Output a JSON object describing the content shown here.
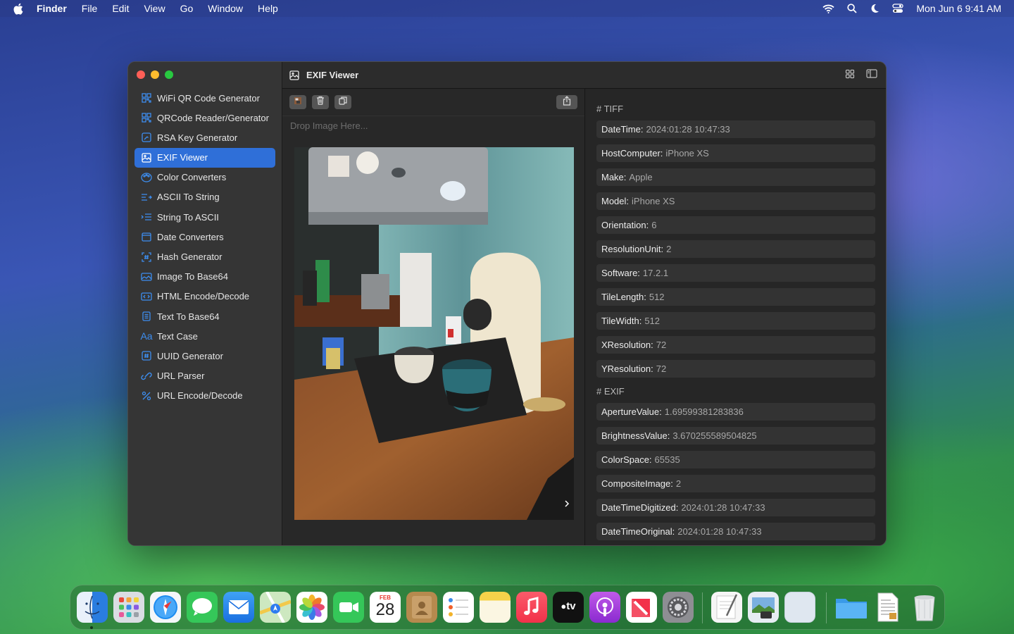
{
  "menubar": {
    "app_name": "Finder",
    "menus": [
      "File",
      "Edit",
      "View",
      "Go",
      "Window",
      "Help"
    ],
    "clock": "Mon Jun 6  9:41 AM"
  },
  "window": {
    "title": "EXIF Viewer",
    "sidebar": {
      "items": [
        {
          "label": "WiFi QR Code Generator",
          "icon": "qrcode-icon"
        },
        {
          "label": "QRCode Reader/Generator",
          "icon": "qrcode-icon"
        },
        {
          "label": "RSA Key Generator",
          "icon": "key-icon"
        },
        {
          "label": "EXIF Viewer",
          "icon": "photo-icon",
          "active": true
        },
        {
          "label": "Color Converters",
          "icon": "palette-icon"
        },
        {
          "label": "ASCII To String",
          "icon": "text-lines-icon"
        },
        {
          "label": "String To ASCII",
          "icon": "list-icon"
        },
        {
          "label": "Date Converters",
          "icon": "calendar-icon"
        },
        {
          "label": "Hash Generator",
          "icon": "hash-scan-icon"
        },
        {
          "label": "Image To Base64",
          "icon": "image-icon"
        },
        {
          "label": "HTML Encode/Decode",
          "icon": "code-icon"
        },
        {
          "label": "Text To Base64",
          "icon": "document-icon"
        },
        {
          "label": "Text Case",
          "icon": "text-case-icon"
        },
        {
          "label": "UUID Generator",
          "icon": "number-icon"
        },
        {
          "label": "URL Parser",
          "icon": "link-icon"
        },
        {
          "label": "URL Encode/Decode",
          "icon": "percent-icon"
        }
      ]
    },
    "left_panel": {
      "drop_placeholder": "Drop Image Here..."
    },
    "exif": {
      "tiff_header": "# TIFF",
      "tiff": [
        {
          "key": "DateTime:",
          "value": "2024:01:28 10:47:33"
        },
        {
          "key": "HostComputer:",
          "value": "iPhone XS"
        },
        {
          "key": "Make:",
          "value": "Apple"
        },
        {
          "key": "Model:",
          "value": "iPhone XS"
        },
        {
          "key": "Orientation:",
          "value": "6"
        },
        {
          "key": "ResolutionUnit:",
          "value": "2"
        },
        {
          "key": "Software:",
          "value": "17.2.1"
        },
        {
          "key": "TileLength:",
          "value": "512"
        },
        {
          "key": "TileWidth:",
          "value": "512"
        },
        {
          "key": "XResolution:",
          "value": "72"
        },
        {
          "key": "YResolution:",
          "value": "72"
        }
      ],
      "exif_header": "# EXIF",
      "exif": [
        {
          "key": "ApertureValue:",
          "value": "1.69599381283836"
        },
        {
          "key": "BrightnessValue:",
          "value": "3.670255589504825"
        },
        {
          "key": "ColorSpace:",
          "value": "65535"
        },
        {
          "key": "CompositeImage:",
          "value": "2"
        },
        {
          "key": "DateTimeDigitized:",
          "value": "2024:01:28 10:47:33"
        },
        {
          "key": "DateTimeOriginal:",
          "value": "2024:01:28 10:47:33"
        }
      ]
    }
  },
  "dock": {
    "calendar_month": "FEB",
    "calendar_day": "28",
    "tv_label": "tv",
    "apps": [
      "finder",
      "launchpad",
      "safari",
      "messages",
      "mail",
      "maps",
      "photos",
      "facetime",
      "calendar",
      "contacts",
      "reminders",
      "notes",
      "music",
      "tv",
      "podcasts",
      "news",
      "system-settings",
      "textedit",
      "preview",
      "blank-app",
      "folder",
      "document",
      "trash"
    ]
  }
}
